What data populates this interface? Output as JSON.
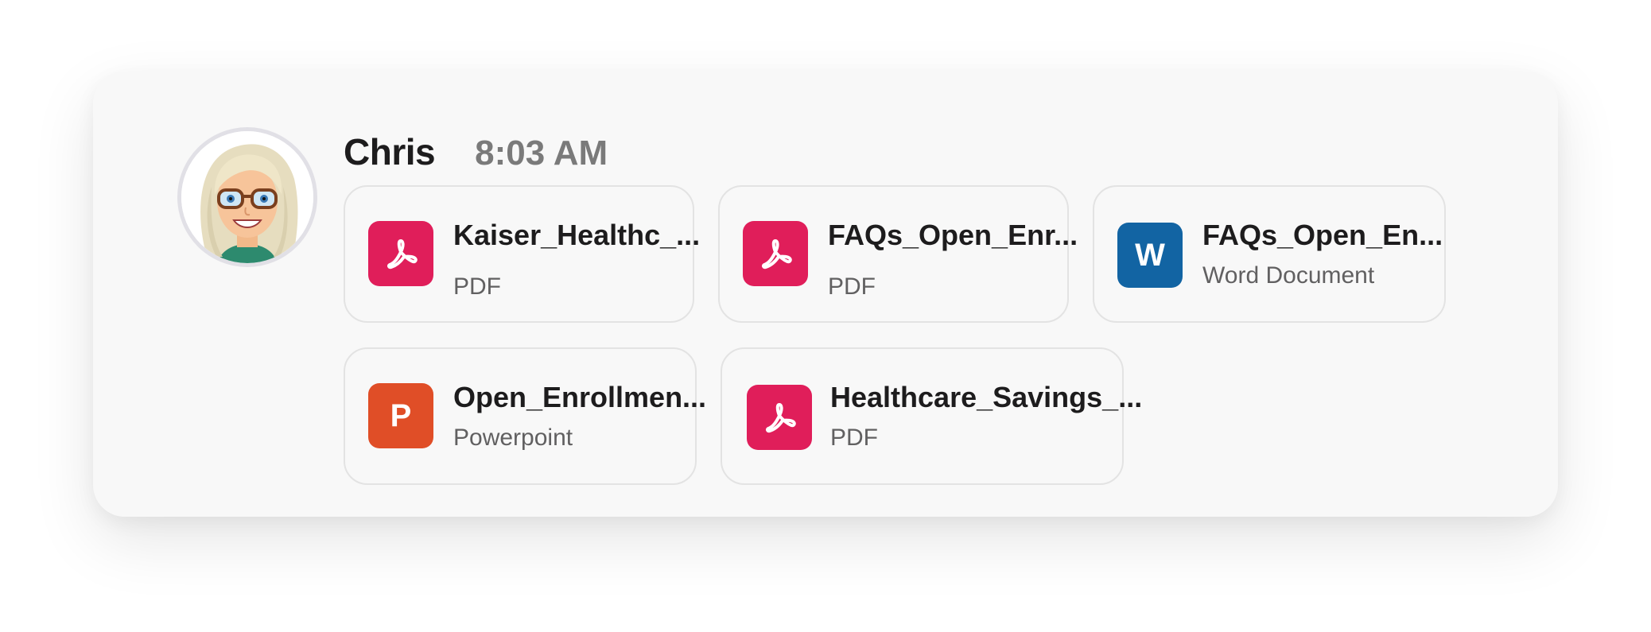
{
  "message": {
    "sender": "Chris",
    "timestamp": "8:03 AM"
  },
  "files": [
    {
      "name": "Kaiser_Healthc_...",
      "type": "PDF",
      "icon": "pdf-icon",
      "icon_color": "#e01e5a"
    },
    {
      "name": "FAQs_Open_Enr...",
      "type": "PDF",
      "icon": "pdf-icon",
      "icon_color": "#e01e5a"
    },
    {
      "name": "FAQs_Open_En...",
      "type": "Word Document",
      "icon": "word-icon",
      "icon_letter": "W",
      "icon_color": "#1264a3"
    },
    {
      "name": "Open_Enrollmen...",
      "type": "Powerpoint",
      "icon": "powerpoint-icon",
      "icon_letter": "P",
      "icon_color": "#e04e27"
    },
    {
      "name": "Healthcare_Savings_...",
      "type": "PDF",
      "icon": "pdf-icon",
      "icon_color": "#e01e5a"
    }
  ],
  "colors": {
    "card_background": "#f8f8f8",
    "pdf": "#e01e5a",
    "word": "#1264a3",
    "powerpoint": "#e04e27"
  }
}
